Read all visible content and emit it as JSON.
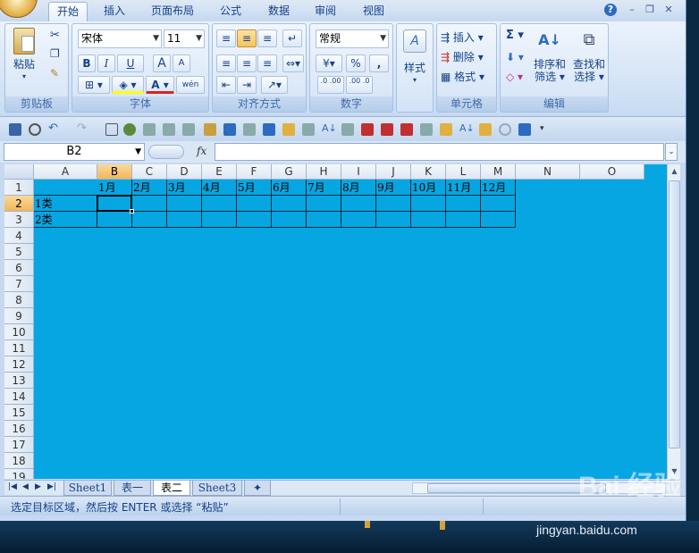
{
  "ribbon_tabs": [
    "开始",
    "插入",
    "页面布局",
    "公式",
    "数据",
    "审阅",
    "视图"
  ],
  "clipboard": {
    "paste_label": "粘贴",
    "group_label": "剪贴板"
  },
  "font": {
    "name": "宋体",
    "size": "11",
    "group_label": "字体",
    "bold": "B",
    "italic": "I",
    "underline": "U",
    "grow": "A",
    "shrink": "A",
    "phonetic": "wén"
  },
  "alignment": {
    "group_label": "对齐方式"
  },
  "number": {
    "format": "常规",
    "group_label": "数字",
    "percent": "%",
    "comma": ",",
    "inc_decimal": ".0 .00",
    "dec_decimal": ".00 .0"
  },
  "styles": {
    "label": "样式"
  },
  "cells": {
    "insert_label": "插入",
    "delete_label": "删除",
    "format_label": "格式",
    "group_label": "单元格"
  },
  "editing": {
    "sort_label": "排序和",
    "sort_label2": "筛选",
    "find_label": "查找和",
    "find_label2": "选择",
    "group_label": "编辑",
    "sigma": "Σ"
  },
  "formula_bar": {
    "name_box": "B2",
    "fx": "fx",
    "value": ""
  },
  "columns": [
    "A",
    "B",
    "C",
    "D",
    "E",
    "F",
    "G",
    "H",
    "I",
    "J",
    "K",
    "L",
    "M",
    "N",
    "O"
  ],
  "rows": [
    "1",
    "2",
    "3",
    "4",
    "5",
    "6",
    "7",
    "8",
    "9",
    "10",
    "11",
    "12",
    "13",
    "14",
    "15",
    "16",
    "17",
    "18",
    "19"
  ],
  "cells_data": {
    "row1": [
      "",
      "1月",
      "2月",
      "3月",
      "4月",
      "5月",
      "6月",
      "7月",
      "8月",
      "9月",
      "10月",
      "11月",
      "12月"
    ],
    "row2": [
      "1类",
      "",
      "",
      "",
      "",
      "",
      "",
      "",
      "",
      "",
      "",
      "",
      ""
    ],
    "row3": [
      "2类",
      "",
      "",
      "",
      "",
      "",
      "",
      "",
      "",
      "",
      "",
      "",
      ""
    ]
  },
  "sheet_tabs": [
    "Sheet1",
    "表一",
    "表二",
    "Sheet3"
  ],
  "active_sheet": "表二",
  "status_text": "选定目标区域，然后按 ENTER 或选择 “粘贴”",
  "colors": {
    "sheet_background": "#06a6e2",
    "ribbon": "#c6d9f1"
  },
  "watermark": {
    "logo": "Bai 经验",
    "url": "jingyan.baidu.com"
  }
}
